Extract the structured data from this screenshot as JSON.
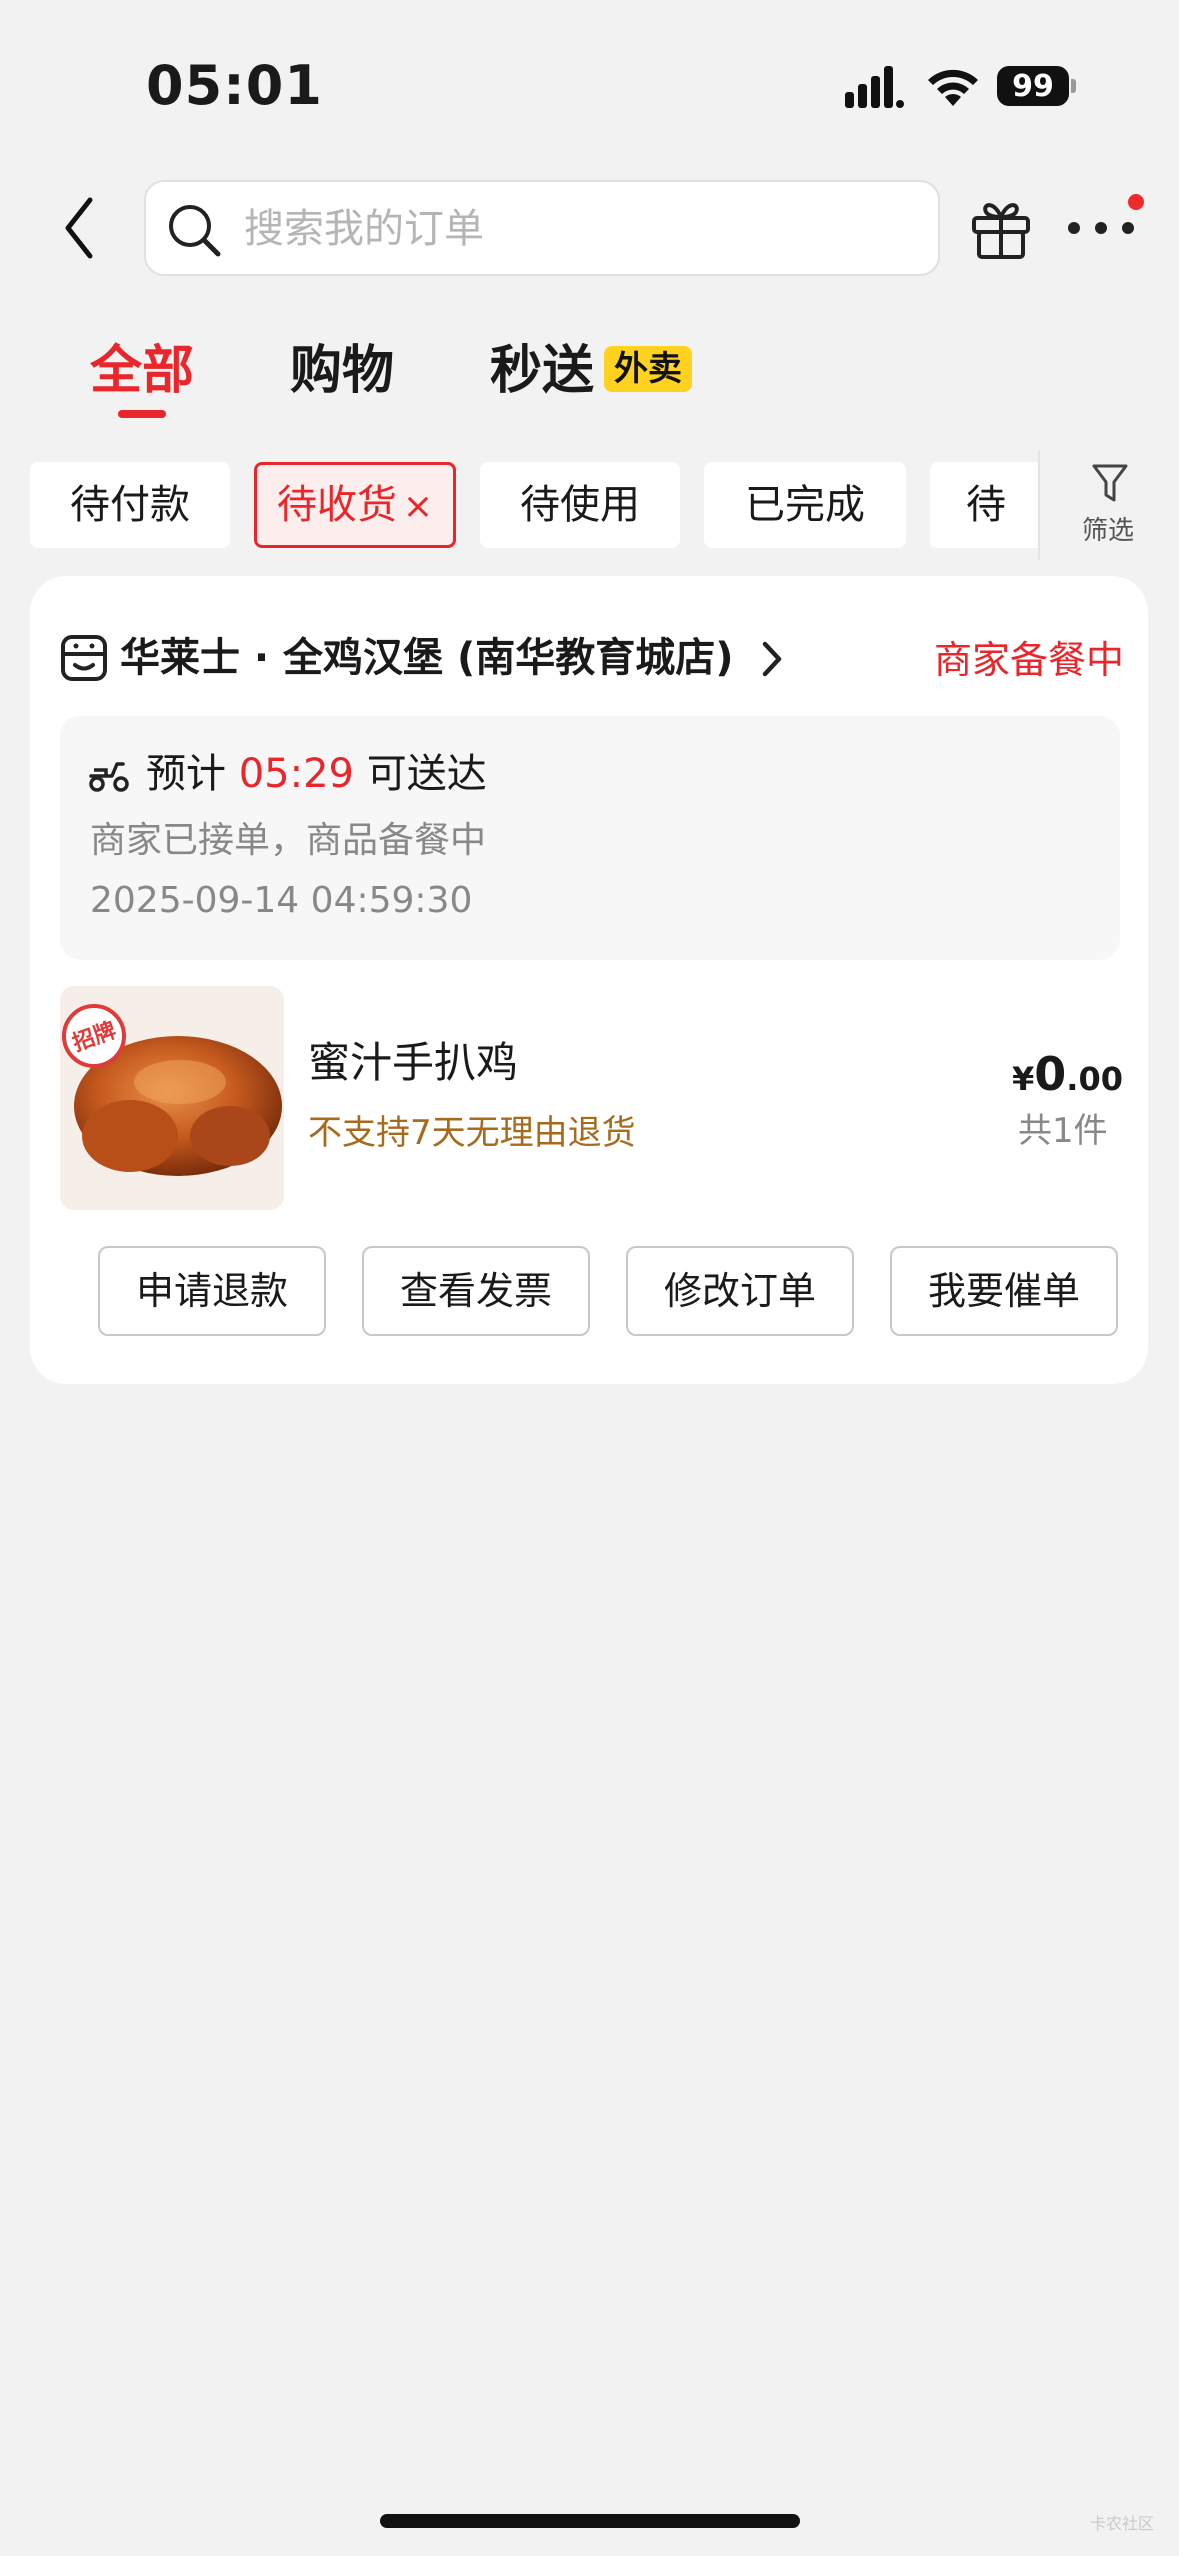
{
  "status_bar": {
    "time": "05:01",
    "battery": "99"
  },
  "header": {
    "search_placeholder": "搜索我的订单"
  },
  "tabs": [
    {
      "label": "全部",
      "active": true
    },
    {
      "label": "购物"
    },
    {
      "label": "秒送",
      "tag": "外卖"
    }
  ],
  "filters": {
    "chips": [
      "待付款",
      "待收货",
      "待使用",
      "已完成",
      "待评"
    ],
    "active_index": 1,
    "clear_symbol": "×",
    "filter_label": "筛选"
  },
  "order": {
    "store_name": "华莱士 · 全鸡汉堡 (南华教育城店)",
    "status": "商家备餐中",
    "eta_prefix": "预计",
    "eta_time": "05:29",
    "eta_suffix": "可送达",
    "description": "商家已接单，商品备餐中",
    "datetime": "2025-09-14 04:59:30",
    "item": {
      "name": "蜜汁手扒鸡",
      "policy": "不支持7天无理由退货",
      "thumb_badge": "招牌",
      "currency": "¥",
      "price_int": "0",
      "price_dec": ".00",
      "count": "共1件"
    },
    "actions": [
      "申请退款",
      "查看发票",
      "修改订单",
      "我要催单"
    ]
  },
  "colors": {
    "accent": "#e8262b",
    "tag_yellow": "#ffd21f",
    "policy_brown": "#a86a1c"
  },
  "watermark": "卡农社区"
}
